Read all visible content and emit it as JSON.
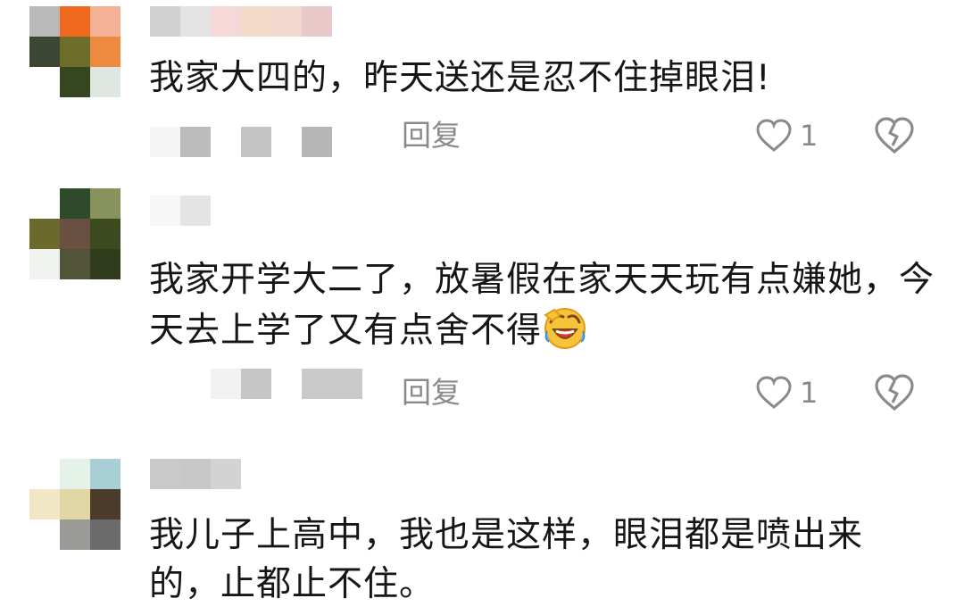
{
  "comments": [
    {
      "text": "我家大四的，昨天送还是忍不住掉眼泪!",
      "reply_label": "回复",
      "likes": "1",
      "avatar_colors": [
        "#b9b9b9",
        "#ef6a1e",
        "#f3b195",
        "#3c4632",
        "#6c6e2a",
        "#ed8a3f",
        "#ffffff",
        "#36471f",
        "#dfe5df"
      ],
      "name_colors": [
        "#d0d0d0",
        "#e3e3e3",
        "#f6d8d8",
        "#f2dcc7",
        "#f0d9cc",
        "#e9c9c9"
      ]
    },
    {
      "text": "我家开学大二了，放暑假在家天天玩有点嫌她，今天去上学了又有点舍不得",
      "reply_label": "回复",
      "likes": "1",
      "avatar_colors": [
        "#ffffff",
        "#2e4a2a",
        "#88925d",
        "#6b6a2c",
        "#6a5040",
        "#3d4a1f",
        "#eff2ef",
        "#525438",
        "#303b1b"
      ],
      "name_colors": [
        "#f1f1f1",
        "#e4e4e4"
      ]
    },
    {
      "text": "我儿子上高中，我也是这样，眼泪都是喷出来的，止都止不住。",
      "avatar_colors": [
        "#ffffff",
        "#e4f2e8",
        "#a8cfd6",
        "#f1e6c6",
        "#e1d7a5",
        "#4a3b2a",
        "#ffffff",
        "#9a9a96",
        "#6b6b6b"
      ],
      "name_colors": [
        "#c9c9c9",
        "#c7c7c7",
        "#d3d3d3"
      ]
    }
  ],
  "icons": {
    "like": "heart-outline-icon",
    "dislike": "broken-heart-icon",
    "emoji": "crying-laughing-emoji-icon"
  }
}
